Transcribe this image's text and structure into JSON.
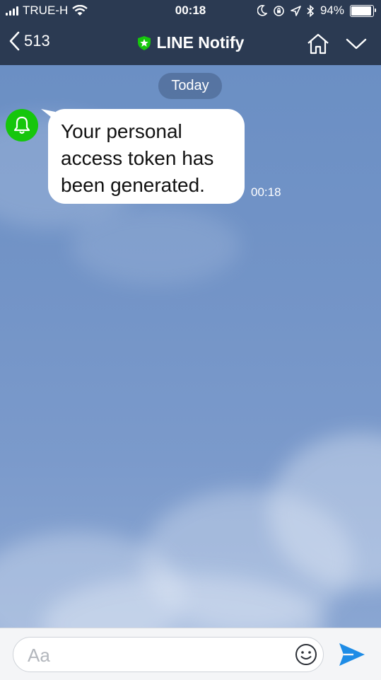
{
  "status_bar": {
    "carrier": "TRUE-H",
    "time": "00:18",
    "battery_percent": "94%",
    "battery_level": 0.94
  },
  "header": {
    "back_count": "513",
    "title": "LINE Notify",
    "icons": [
      "chevron-left-icon",
      "shield-star-icon",
      "home-icon",
      "chevron-down-icon"
    ]
  },
  "chat": {
    "date_label": "Today",
    "messages": [
      {
        "sender_icon": "bell-icon",
        "text": "Your personal access token has been generated.",
        "time": "00:18"
      }
    ]
  },
  "input": {
    "placeholder": "Aa",
    "icons": [
      "emoji-icon",
      "send-icon"
    ]
  },
  "colors": {
    "header_bg": "#2b3a52",
    "chat_bg": "#7394c7",
    "avatar_green": "#16c60c",
    "send_blue": "#1e8ce6"
  }
}
